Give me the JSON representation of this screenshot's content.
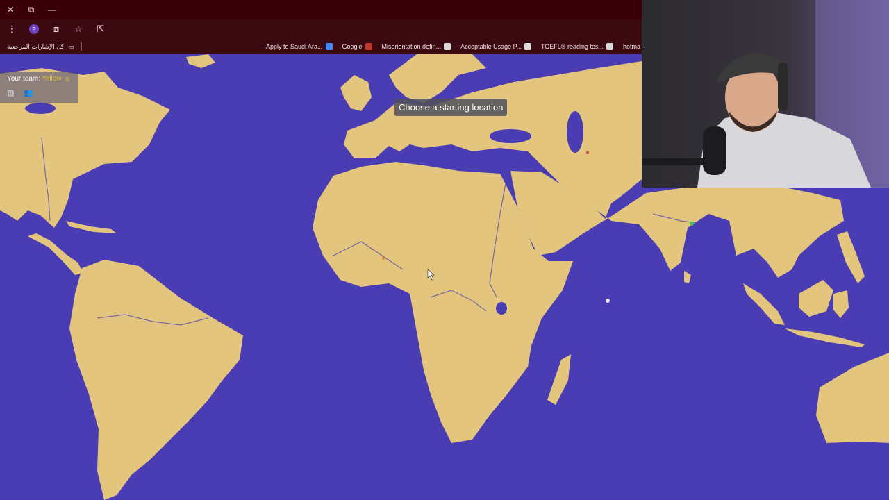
{
  "browser": {
    "window_controls": {
      "close": "✕",
      "restore": "⧉",
      "minimize": "—"
    },
    "bookmarks_folder": "كل الإشارات المرجعية",
    "bookmarks": [
      {
        "label": "Apply to Saudi Ara...",
        "color": "#d9d9d9"
      },
      {
        "label": "Google",
        "color": "#4285f4"
      },
      {
        "label": "Misorientation defin...",
        "color": "#c0392b"
      },
      {
        "label": "Acceptable Usage P...",
        "color": "#d9d9d9"
      },
      {
        "label": "TOEFL® reading tes...",
        "color": "#d9d9d9"
      },
      {
        "label": "hotma",
        "color": "#d9d9d9"
      }
    ]
  },
  "game": {
    "team_label": "Your team:",
    "team_value": "Yellow",
    "team_color": "#e3c23a",
    "prompt": "Choose a starting location",
    "ocean_color": "#4a3db3",
    "land_color": "#e4c57d"
  },
  "webcam": {
    "present": true
  }
}
